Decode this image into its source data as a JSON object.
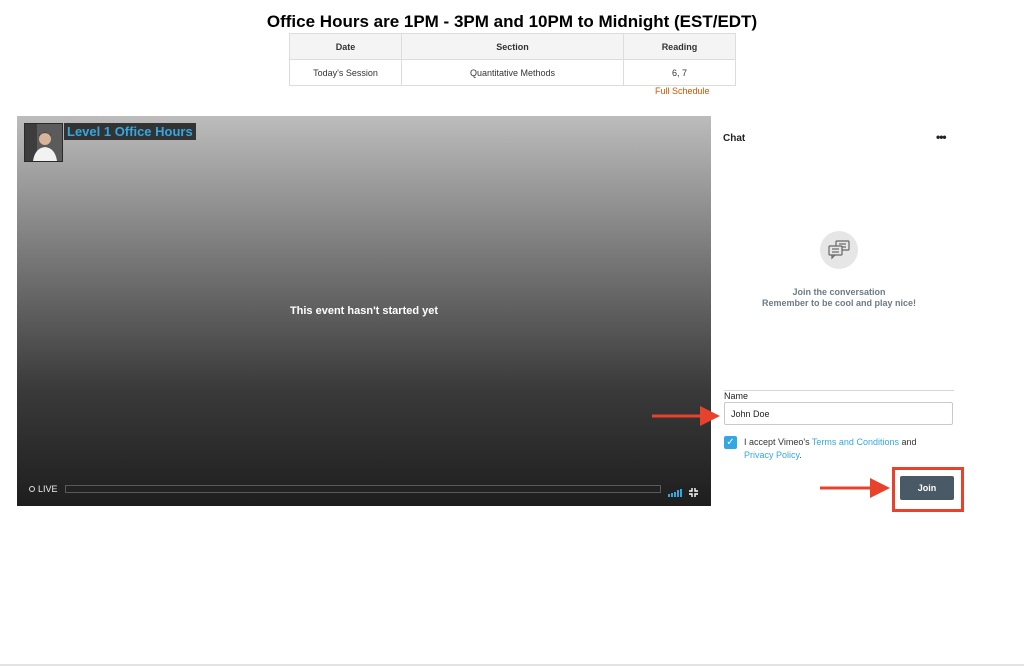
{
  "page": {
    "title": "Office Hours are 1PM - 3PM and 10PM to Midnight (EST/EDT)"
  },
  "schedule": {
    "headers": [
      "Date",
      "Section",
      "Reading"
    ],
    "row": {
      "date": "Today's Session",
      "section": "Quantitative Methods",
      "reading": "6, 7"
    },
    "link": "Full Schedule"
  },
  "player": {
    "event_title": "Level 1 Office Hours",
    "message": "This event hasn't started yet",
    "live_label": "LIVE"
  },
  "chat": {
    "title": "Chat",
    "menu": "•••",
    "empty_line1": "Join the conversation",
    "empty_line2": "Remember to be cool and play nice!",
    "name_label": "Name",
    "name_value": "John Doe",
    "terms_prefix": "I accept Vimeo's ",
    "terms_link": "Terms and Conditions",
    "terms_and": " and",
    "privacy_link": "Privacy Policy",
    "terms_suffix": ".",
    "checkbox_checked": true,
    "join_label": "Join"
  },
  "colors": {
    "accent_blue": "#35a7e0",
    "link_orange": "#d35400",
    "annotation_red": "#e8412c",
    "join_button": "#4a5966"
  },
  "icons": [
    "chat-bubbles-icon",
    "quality-bars-icon",
    "fullscreen-icon",
    "checkmark-icon",
    "arrow-icon"
  ]
}
